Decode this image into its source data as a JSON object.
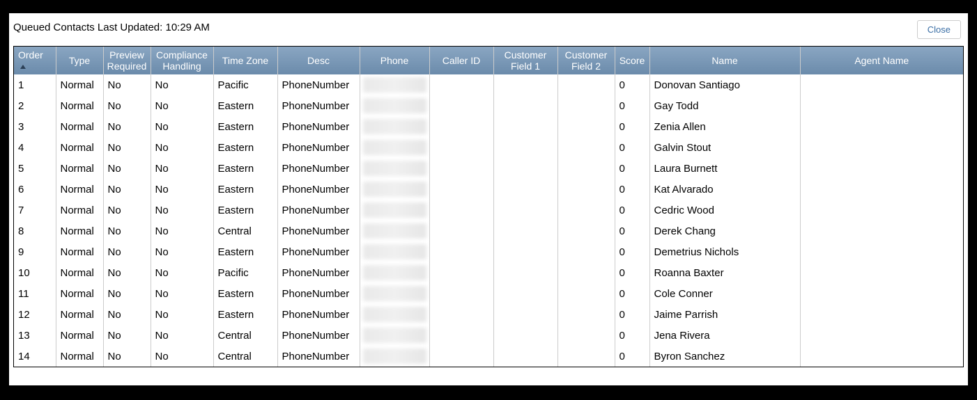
{
  "header": {
    "status_text": "Queued Contacts Last Updated: 10:29 AM",
    "close_label": "Close"
  },
  "columns": {
    "order": "Order",
    "type": "Type",
    "preview_required": "Preview Required",
    "compliance_handling": "Compliance Handling",
    "time_zone": "Time Zone",
    "desc": "Desc",
    "phone": "Phone",
    "caller_id": "Caller ID",
    "customer_field_1": "Customer Field 1",
    "customer_field_2": "Customer Field 2",
    "score": "Score",
    "name": "Name",
    "agent_name": "Agent Name"
  },
  "sort": {
    "column": "order",
    "direction": "asc"
  },
  "rows": [
    {
      "order": "1",
      "type": "Normal",
      "preview_required": "No",
      "compliance_handling": "No",
      "time_zone": "Pacific",
      "desc": "PhoneNumber",
      "phone": "",
      "caller_id": "",
      "customer_field_1": "",
      "customer_field_2": "",
      "score": "0",
      "name": "Donovan Santiago",
      "agent_name": ""
    },
    {
      "order": "2",
      "type": "Normal",
      "preview_required": "No",
      "compliance_handling": "No",
      "time_zone": "Eastern",
      "desc": "PhoneNumber",
      "phone": "",
      "caller_id": "",
      "customer_field_1": "",
      "customer_field_2": "",
      "score": "0",
      "name": "Gay Todd",
      "agent_name": ""
    },
    {
      "order": "3",
      "type": "Normal",
      "preview_required": "No",
      "compliance_handling": "No",
      "time_zone": "Eastern",
      "desc": "PhoneNumber",
      "phone": "",
      "caller_id": "",
      "customer_field_1": "",
      "customer_field_2": "",
      "score": "0",
      "name": "Zenia Allen",
      "agent_name": ""
    },
    {
      "order": "4",
      "type": "Normal",
      "preview_required": "No",
      "compliance_handling": "No",
      "time_zone": "Eastern",
      "desc": "PhoneNumber",
      "phone": "",
      "caller_id": "",
      "customer_field_1": "",
      "customer_field_2": "",
      "score": "0",
      "name": "Galvin Stout",
      "agent_name": ""
    },
    {
      "order": "5",
      "type": "Normal",
      "preview_required": "No",
      "compliance_handling": "No",
      "time_zone": "Eastern",
      "desc": "PhoneNumber",
      "phone": "",
      "caller_id": "",
      "customer_field_1": "",
      "customer_field_2": "",
      "score": "0",
      "name": "Laura Burnett",
      "agent_name": ""
    },
    {
      "order": "6",
      "type": "Normal",
      "preview_required": "No",
      "compliance_handling": "No",
      "time_zone": "Eastern",
      "desc": "PhoneNumber",
      "phone": "",
      "caller_id": "",
      "customer_field_1": "",
      "customer_field_2": "",
      "score": "0",
      "name": "Kat Alvarado",
      "agent_name": ""
    },
    {
      "order": "7",
      "type": "Normal",
      "preview_required": "No",
      "compliance_handling": "No",
      "time_zone": "Eastern",
      "desc": "PhoneNumber",
      "phone": "",
      "caller_id": "",
      "customer_field_1": "",
      "customer_field_2": "",
      "score": "0",
      "name": "Cedric Wood",
      "agent_name": ""
    },
    {
      "order": "8",
      "type": "Normal",
      "preview_required": "No",
      "compliance_handling": "No",
      "time_zone": "Central",
      "desc": "PhoneNumber",
      "phone": "",
      "caller_id": "",
      "customer_field_1": "",
      "customer_field_2": "",
      "score": "0",
      "name": "Derek Chang",
      "agent_name": ""
    },
    {
      "order": "9",
      "type": "Normal",
      "preview_required": "No",
      "compliance_handling": "No",
      "time_zone": "Eastern",
      "desc": "PhoneNumber",
      "phone": "",
      "caller_id": "",
      "customer_field_1": "",
      "customer_field_2": "",
      "score": "0",
      "name": "Demetrius Nichols",
      "agent_name": ""
    },
    {
      "order": "10",
      "type": "Normal",
      "preview_required": "No",
      "compliance_handling": "No",
      "time_zone": "Pacific",
      "desc": "PhoneNumber",
      "phone": "",
      "caller_id": "",
      "customer_field_1": "",
      "customer_field_2": "",
      "score": "0",
      "name": "Roanna Baxter",
      "agent_name": ""
    },
    {
      "order": "11",
      "type": "Normal",
      "preview_required": "No",
      "compliance_handling": "No",
      "time_zone": "Eastern",
      "desc": "PhoneNumber",
      "phone": "",
      "caller_id": "",
      "customer_field_1": "",
      "customer_field_2": "",
      "score": "0",
      "name": "Cole Conner",
      "agent_name": ""
    },
    {
      "order": "12",
      "type": "Normal",
      "preview_required": "No",
      "compliance_handling": "No",
      "time_zone": "Eastern",
      "desc": "PhoneNumber",
      "phone": "",
      "caller_id": "",
      "customer_field_1": "",
      "customer_field_2": "",
      "score": "0",
      "name": "Jaime Parrish",
      "agent_name": ""
    },
    {
      "order": "13",
      "type": "Normal",
      "preview_required": "No",
      "compliance_handling": "No",
      "time_zone": "Central",
      "desc": "PhoneNumber",
      "phone": "",
      "caller_id": "",
      "customer_field_1": "",
      "customer_field_2": "",
      "score": "0",
      "name": "Jena Rivera",
      "agent_name": ""
    },
    {
      "order": "14",
      "type": "Normal",
      "preview_required": "No",
      "compliance_handling": "No",
      "time_zone": "Central",
      "desc": "PhoneNumber",
      "phone": "",
      "caller_id": "",
      "customer_field_1": "",
      "customer_field_2": "",
      "score": "0",
      "name": "Byron Sanchez",
      "agent_name": ""
    }
  ]
}
